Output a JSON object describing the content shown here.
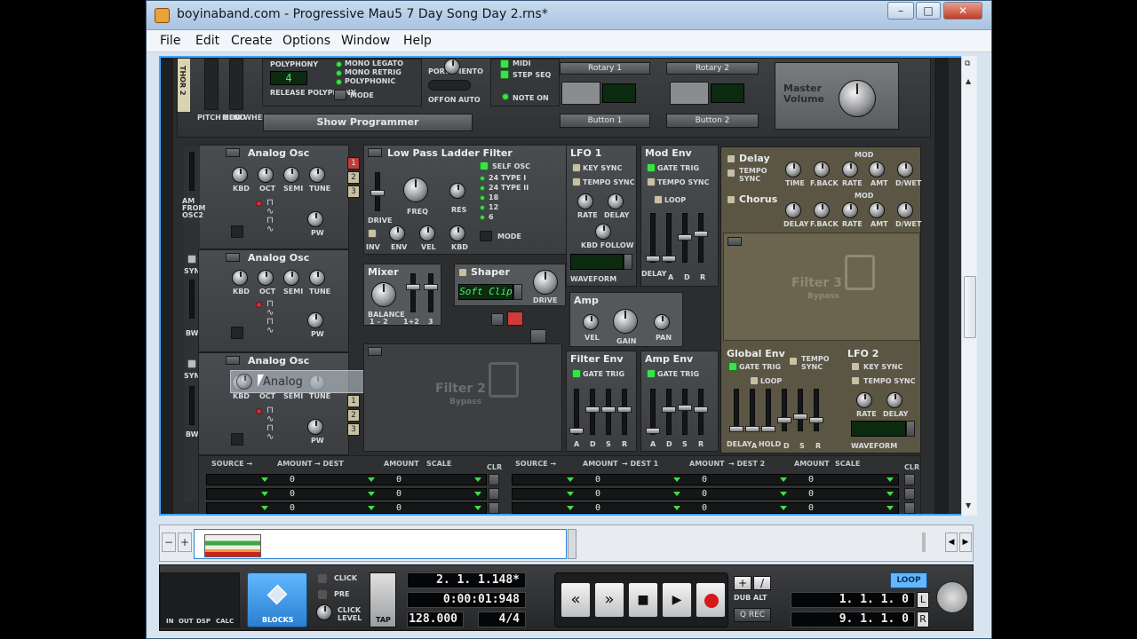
{
  "window": {
    "title": "boyinaband.com - Progressive Mau5 7 Day Song Day 2.rns*",
    "controls": [
      "–",
      "□",
      "✕"
    ]
  },
  "menu": [
    "File",
    "Edit",
    "Create",
    "Options",
    "Window",
    "Help"
  ],
  "top_strip": {
    "device_label": "THOR 2",
    "pitch_bend": "PITCH BEND",
    "mod_wheel": "MOD WHEEL",
    "polyphony_label": "POLYPHONY",
    "polyphony_value": "4",
    "release_polyphony": "RELEASE POLYPHONY",
    "mono_legato": "MONO LEGATO",
    "mono_retrig": "MONO RETRIG",
    "polyphonic": "POLYPHONIC",
    "mode": "MODE",
    "portamento": "PORTAMENTO",
    "porta_off": "OFF",
    "porta_on": "ON",
    "porta_auto": "AUTO",
    "midi": "MIDI",
    "step_seq": "STEP SEQ",
    "note_on": "NOTE ON",
    "show_programmer": "Show Programmer",
    "rotary1": "Rotary 1",
    "rotary2": "Rotary 2",
    "button1": "Button 1",
    "button2": "Button 2",
    "master_volume": "Master Volume"
  },
  "osc": {
    "title": "Analog Osc",
    "kbd": "KBD",
    "oct": "OCT",
    "semi": "SEMI",
    "tune": "TUNE",
    "pw": "PW",
    "am_from_osc2": "AM FROM OSC2",
    "sync": "SYNC",
    "bw": "BW",
    "slot_numbers": [
      "1",
      "2",
      "3"
    ],
    "drag_ghost_label": "Analog"
  },
  "filter1": {
    "title": "Low Pass Ladder Filter",
    "self_osc": "SELF OSC",
    "types": [
      "24 TYPE I",
      "24 TYPE II",
      "18",
      "12",
      "6"
    ],
    "drive": "DRIVE",
    "freq": "FREQ",
    "res": "RES",
    "inv": "INV",
    "env": "ENV",
    "vel": "VEL",
    "kbd": "KBD",
    "mode": "MODE"
  },
  "mixer": {
    "title": "Mixer",
    "balance": "BALANCE",
    "b1": "1 – 2",
    "b2": "1+2",
    "b3": "3"
  },
  "shaper": {
    "title": "Shaper",
    "mode_value": "Soft Clip",
    "drive": "DRIVE"
  },
  "amp": {
    "title": "Amp",
    "vel": "VEL",
    "gain": "GAIN",
    "pan": "PAN"
  },
  "filter2": {
    "title": "Filter 2",
    "sub": "Bypass"
  },
  "filter3": {
    "title": "Filter 3",
    "sub": "Bypass"
  },
  "lfo1": {
    "title": "LFO 1",
    "key_sync": "KEY SYNC",
    "tempo_sync": "TEMPO SYNC",
    "rate": "RATE",
    "delay": "DELAY",
    "kbd_follow": "KBD FOLLOW",
    "waveform": "WAVEFORM"
  },
  "mod_env": {
    "title": "Mod Env",
    "gate_trig": "GATE TRIG",
    "tempo_sync": "TEMPO SYNC",
    "loop": "LOOP",
    "delay": "DELAY",
    "a": "A",
    "d": "D",
    "r": "R"
  },
  "filter_env": {
    "title": "Filter Env",
    "gate_trig": "GATE TRIG",
    "a": "A",
    "d": "D",
    "s": "S",
    "r": "R"
  },
  "amp_env": {
    "title": "Amp Env",
    "gate_trig": "GATE TRIG",
    "a": "A",
    "d": "D",
    "s": "S",
    "r": "R"
  },
  "delay": {
    "title": "Delay",
    "tempo_sync": "TEMPO SYNC",
    "time": "TIME",
    "fback": "F.BACK",
    "mod": "MOD",
    "rate": "RATE",
    "amt": "AMT",
    "dwet": "D/WET"
  },
  "chorus": {
    "title": "Chorus",
    "delay": "DELAY",
    "fback": "F.BACK",
    "mod": "MOD",
    "rate": "RATE",
    "amt": "AMT",
    "dwet": "D/WET"
  },
  "global_env": {
    "title": "Global Env",
    "gate_trig": "GATE TRIG",
    "tempo_sync": "TEMPO SYNC",
    "loop": "LOOP",
    "delay": "DELAY",
    "a": "A",
    "hold": "HOLD",
    "d": "D",
    "s": "S",
    "r": "R"
  },
  "lfo2": {
    "title": "LFO 2",
    "key_sync": "KEY SYNC",
    "tempo_sync": "TEMPO SYNC",
    "rate": "RATE",
    "delay": "DELAY",
    "waveform": "WAVEFORM"
  },
  "mod_bus_left": {
    "headers": [
      "SOURCE →",
      "AMOUNT",
      "→ DEST",
      "AMOUNT",
      "SCALE",
      "CLR"
    ],
    "values": [
      "0",
      "0",
      "0",
      "0",
      "0",
      "0"
    ]
  },
  "mod_bus_right": {
    "headers": [
      "SOURCE →",
      "AMOUNT",
      "→ DEST 1",
      "AMOUNT",
      "→ DEST 2",
      "AMOUNT",
      "SCALE",
      "CLR"
    ],
    "values": [
      "0",
      "0",
      "0",
      "0",
      "0",
      "0",
      "0",
      "0",
      "0"
    ]
  },
  "transport": {
    "in_out_labels": [
      "IN",
      "OUT",
      "DSP",
      "CALC"
    ],
    "blocks": "BLOCKS",
    "click": "CLICK",
    "pre": "PRE",
    "click_level": "CLICK LEVEL",
    "tap": "TAP",
    "position": "2. 1. 1.148*",
    "time": "0:00:01:948",
    "tempo": "128.000",
    "signature": "4/4",
    "dub": "DUB",
    "alt": "ALT",
    "q_rec": "Q REC",
    "loop": "LOOP",
    "left_locator": "1. 1. 1.   0",
    "right_locator": "9. 1. 1.   0",
    "l": "L",
    "r": "R"
  },
  "colors": {
    "accent": "#3fa4ff",
    "led_green": "#3de04b",
    "record_red": "#d41a1a",
    "loop_blue": "#62b7ff"
  }
}
